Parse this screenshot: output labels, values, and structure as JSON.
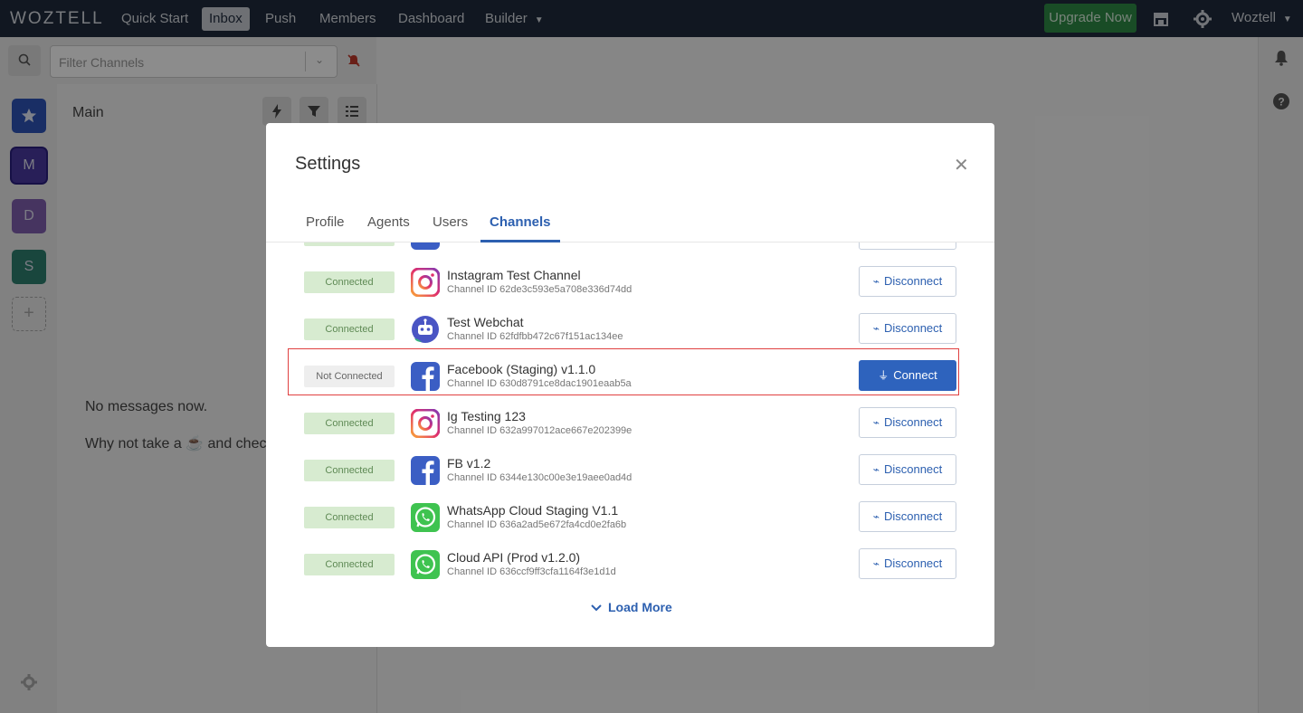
{
  "nav": {
    "brand": "WOZTELL",
    "items": [
      "Quick Start",
      "Inbox",
      "Push",
      "Members",
      "Dashboard",
      "Builder"
    ],
    "upgrade": "Upgrade Now",
    "user": "Woztell"
  },
  "sidebar": {
    "filter_placeholder": "Filter Channels",
    "avatars": [
      "M",
      "D",
      "S"
    ],
    "section_title": "Main",
    "empty_line1": "No messages now.",
    "empty_line2": "Why not take a ☕ and chec"
  },
  "modal": {
    "title": "Settings",
    "tabs": [
      "Profile",
      "Agents",
      "Users",
      "Channels"
    ],
    "active_tab": "Channels",
    "load_more": "Load More",
    "channels": [
      {
        "status": "Connected",
        "name": "Instagram Test Channel",
        "id": "Channel ID 62de3c593e5a708e336d74dd",
        "action": "Disconnect",
        "icon": "instagram-icon"
      },
      {
        "status": "Connected",
        "name": "Test Webchat",
        "id": "Channel ID 62fdfbb472c67f151ac134ee",
        "action": "Disconnect",
        "icon": "webchat-bot-icon"
      },
      {
        "status": "Not Connected",
        "name": "Facebook (Staging) v1.1.0",
        "id": "Channel ID 630d8791ce8dac1901eaab5a",
        "action": "Connect",
        "icon": "facebook-icon"
      },
      {
        "status": "Connected",
        "name": "Ig Testing 123",
        "id": "Channel ID 632a997012ace667e202399e",
        "action": "Disconnect",
        "icon": "instagram-icon"
      },
      {
        "status": "Connected",
        "name": "FB v1.2",
        "id": "Channel ID 6344e130c00e3e19aee0ad4d",
        "action": "Disconnect",
        "icon": "facebook-icon"
      },
      {
        "status": "Connected",
        "name": "WhatsApp Cloud Staging V1.1",
        "id": "Channel ID 636a2ad5e672fa4cd0e2fa6b",
        "action": "Disconnect",
        "icon": "whatsapp-icon"
      },
      {
        "status": "Connected",
        "name": "Cloud API (Prod v1.2.0)",
        "id": "Channel ID 636ccf9ff3cfa1164f3e1d1d",
        "action": "Disconnect",
        "icon": "whatsapp-icon"
      }
    ]
  },
  "colors": {
    "accent": "#2e63bd",
    "nav_bg": "#1f2b3d",
    "connected_bg": "#d7ebd0",
    "highlight": "#e04040"
  }
}
